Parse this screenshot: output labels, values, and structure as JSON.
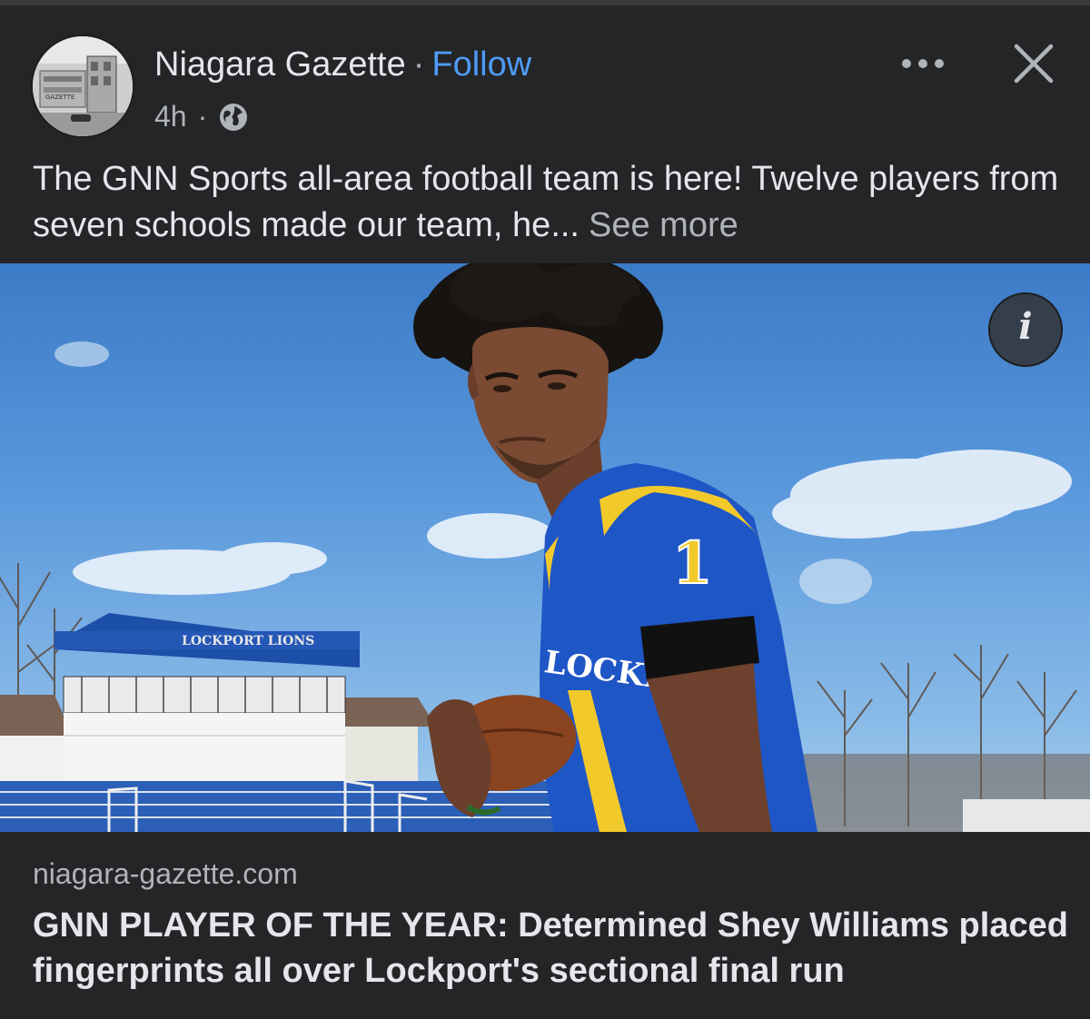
{
  "post": {
    "page_name": "Niagara Gazette",
    "separator": "·",
    "follow_label": "Follow",
    "time_ago": "4h",
    "meta_separator": "·",
    "audience_icon": "globe-icon",
    "more_icon": "more-horizontal-icon",
    "close_icon": "close-icon",
    "text": "The GNN Sports all-area football team is here! Twelve players from seven schools made our team, he...",
    "see_more_label": "See more"
  },
  "avatar": {
    "sign_text": "GAZETTE"
  },
  "photo": {
    "banner_text": "LOCKPORT LIONS",
    "jersey_text": "LOCKPORT",
    "jersey_number": "1",
    "info_icon": "info-icon",
    "info_label": "i"
  },
  "link_preview": {
    "domain": "niagara-gazette.com",
    "headline": "GNN PLAYER OF THE YEAR: Determined Shey Williams placed fingerprints all over Lockport's sectional final run"
  },
  "colors": {
    "background": "#242526",
    "text_primary": "#e4e6eb",
    "text_secondary": "#b0b3b8",
    "link_blue": "#4f9bf7",
    "jersey_blue": "#1f56c6",
    "jersey_gold": "#f2c92b"
  }
}
